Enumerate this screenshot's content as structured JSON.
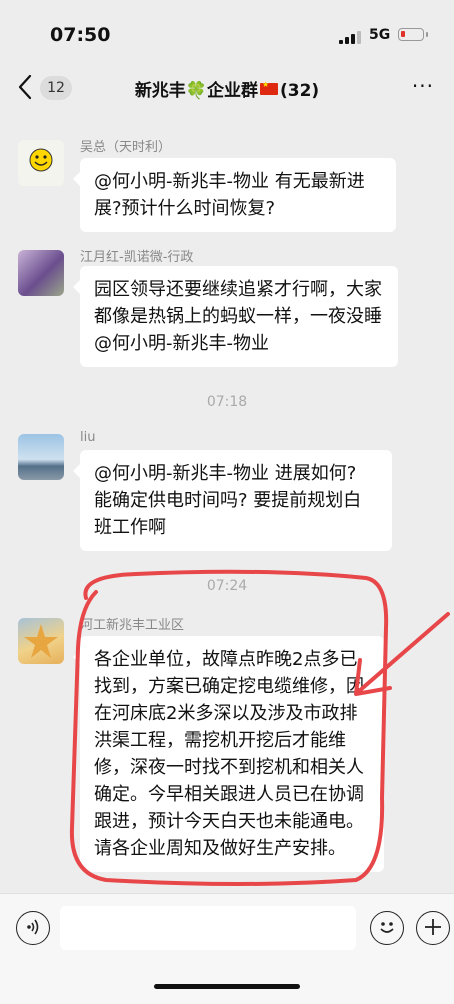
{
  "status_bar": {
    "time": "07:50",
    "network": "5G",
    "battery_level": 0.1,
    "signal_bars": 3
  },
  "nav": {
    "back_icon": "chevron-left-icon",
    "unread_count": "12",
    "title_part1": "新兆丰",
    "title_clover": "🍀",
    "title_part2": "企业群",
    "title_count": "(32)",
    "more_label": "···"
  },
  "messages": [
    {
      "sender": "吴总（天时利）",
      "text": "@何小明-新兆丰-物业 有无最新进展?预计什么时间恢复?"
    },
    {
      "sender": "江月红-凯诺微-行政",
      "text": "园区领导还要继续追紧才行啊，大家都像是热锅上的蚂蚁一样，一夜没睡 @何小明-新兆丰-物业"
    },
    {
      "timestamp": "07:18"
    },
    {
      "sender": "liu",
      "text": "@何小明-新兆丰-物业 进展如何? 能确定供电时间吗? 要提前规划白班工作啊"
    },
    {
      "timestamp": "07:24"
    },
    {
      "sender": "河工新兆丰工业区",
      "text": "各企业单位，故障点昨晚2点多已找到，方案已确定挖电缆维修，因在河床底2米多深以及涉及市政排洪渠工程，需挖机开挖后才能维修，深夜一时找不到挖机和相关人确定。今早相关跟进人员已在协调跟进，预计今天白天也未能通电。请各企业周知及做好生产安排。"
    }
  ],
  "annotation": {
    "color": "#e8474a"
  },
  "input_bar": {
    "voice_icon": "voice-icon",
    "emoji_icon": "emoji-icon",
    "plus_icon": "plus-icon",
    "input_value": ""
  }
}
